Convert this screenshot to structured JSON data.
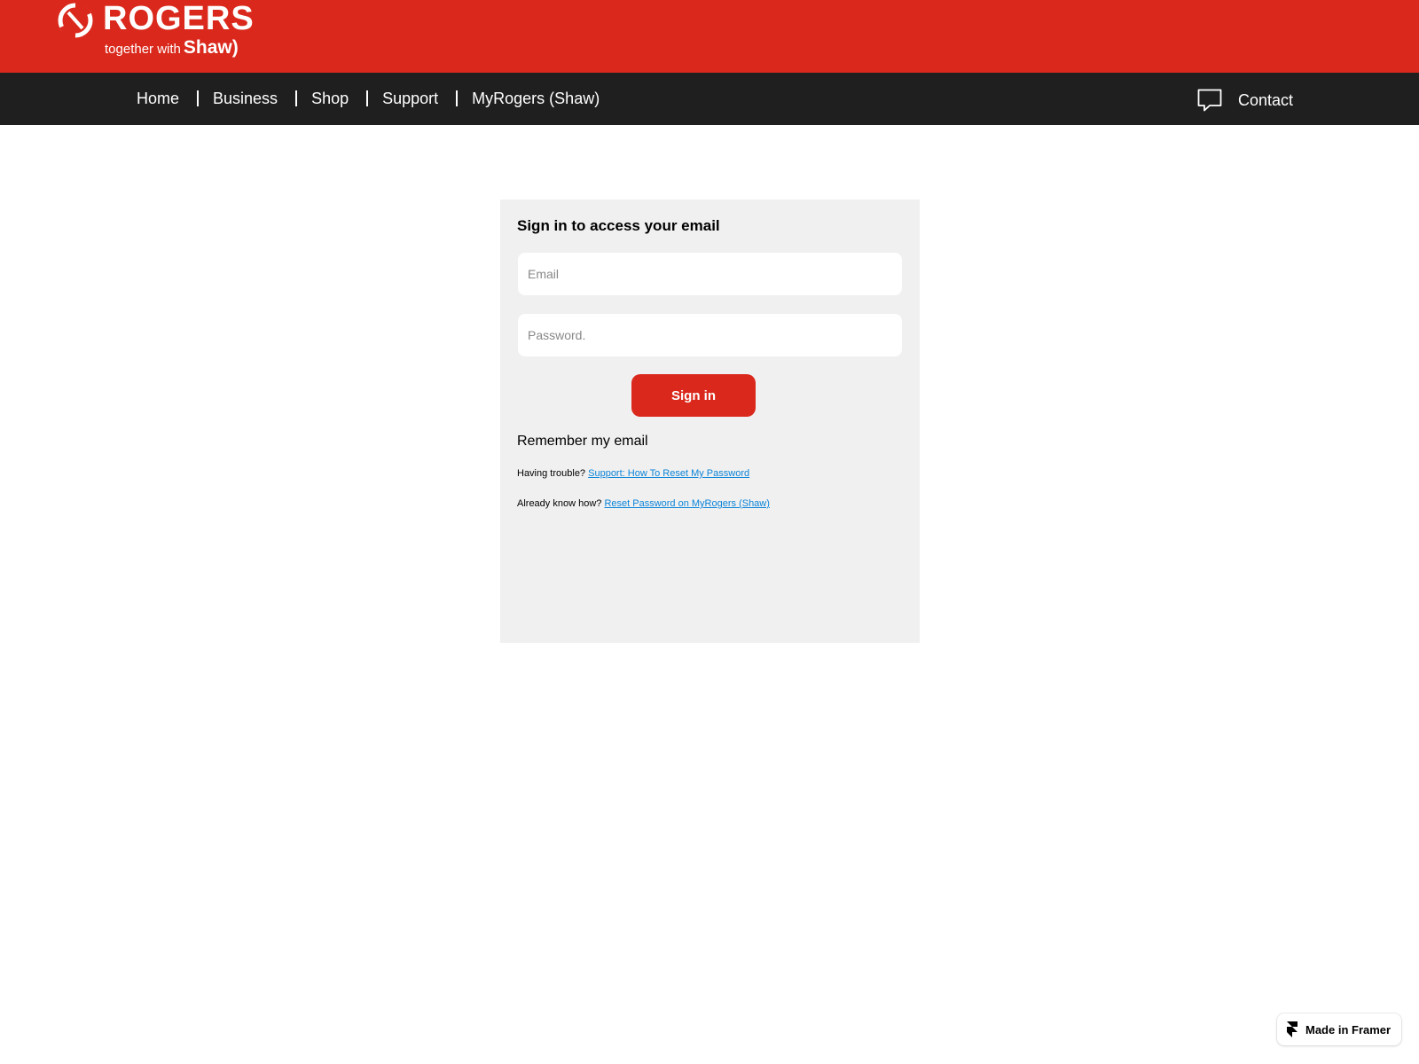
{
  "brand": {
    "name": "ROGERS",
    "tagline": "together with",
    "partner": "Shaw",
    "partner_suffix": ")",
    "primary_color": "#da291c",
    "nav_color": "#1f1f1f"
  },
  "nav": {
    "items": [
      {
        "label": "Home"
      },
      {
        "label": "Business"
      },
      {
        "label": "Shop"
      },
      {
        "label": "Support"
      },
      {
        "label": "MyRogers (Shaw)"
      }
    ],
    "contact_label": "Contact",
    "contact_icon": "chat-bubble-icon"
  },
  "signin": {
    "title": "Sign in to access your email",
    "email_placeholder": "Email",
    "email_value": "",
    "password_placeholder": "Password.",
    "password_value": "",
    "button_label": "Sign in",
    "remember_label": "Remember my email",
    "trouble_text": "Having trouble?",
    "trouble_link": "Support: How To Reset My Password",
    "know_text": "Already know how?",
    "know_link": "Reset Password on MyRogers (Shaw)",
    "link_color": "#0b84d8"
  },
  "badge": {
    "label": "Made in Framer",
    "icon": "framer-icon"
  }
}
